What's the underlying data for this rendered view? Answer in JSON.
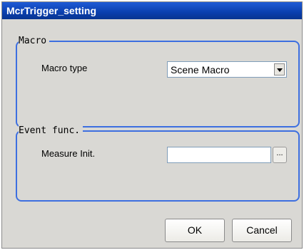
{
  "window": {
    "title": "McrTrigger_setting"
  },
  "macro_group": {
    "legend": "Macro",
    "macro_type_label": "Macro type",
    "macro_type_value": "Scene Macro"
  },
  "event_group": {
    "legend": "Event func.",
    "measure_init_label": "Measure Init.",
    "measure_init_value": "",
    "browse_label": "..."
  },
  "buttons": {
    "ok_label": "OK",
    "cancel_label": "Cancel"
  },
  "colors": {
    "title_bar": "#0a3fae",
    "group_border": "#3d6fe0",
    "dialog_background": "#d9d8d4"
  },
  "icons": {
    "dropdown": "chevron-down-icon"
  }
}
